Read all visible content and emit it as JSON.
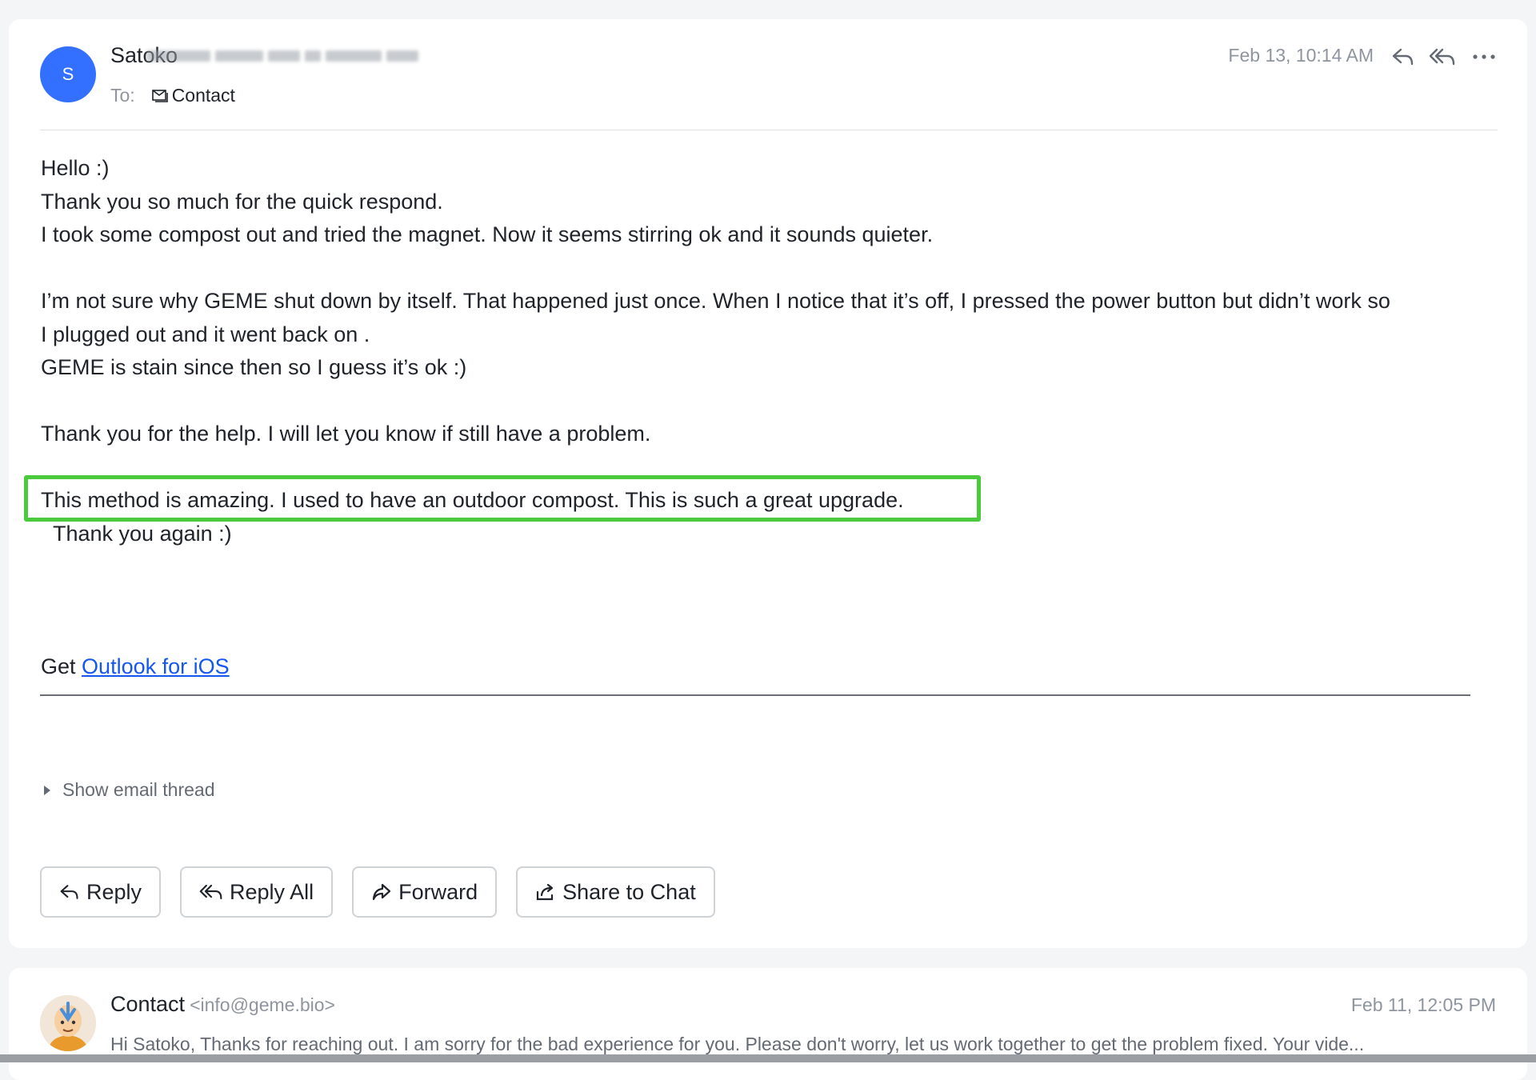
{
  "message": {
    "avatar_initial": "S",
    "sender_name": "Satoko",
    "to_label": "To:",
    "to_recipient": "Contact",
    "date": "Feb 13, 10:14 AM",
    "body_lines": [
      "Hello :)",
      "Thank you so much for the quick respond.",
      "I took some compost out and tried the magnet. Now it seems stirring ok and it sounds quieter.",
      "",
      "I’m not sure why GEME shut down by itself. That happened just once. When I notice that it’s off, I pressed the power button but didn’t work so",
      "I plugged out and it went back on .",
      "GEME is stain since then so I guess it’s ok :)",
      "",
      "Thank you for the help.  I will let you know if still have a problem.",
      "",
      "This method is amazing. I used to have an outdoor compost. This is such a great upgrade.",
      "Thank you again :)"
    ],
    "signature_prefix": "Get",
    "signature_link": "Outlook for iOS",
    "show_thread": "Show email thread",
    "highlight_color": "#4cca3e"
  },
  "actions": {
    "reply": "Reply",
    "reply_all": "Reply All",
    "forward": "Forward",
    "share": "Share to Chat"
  },
  "next_message": {
    "sender_name": "Contact",
    "sender_email": "<info@geme.bio>",
    "date": "Feb 11, 12:05 PM",
    "preview": "Hi Satoko, Thanks for reaching out. I am sorry for the bad experience for you. Please don't worry, let us work together to get the problem fixed. Your vide..."
  },
  "colors": {
    "accent": "#3370ff",
    "link": "#1456f0"
  }
}
